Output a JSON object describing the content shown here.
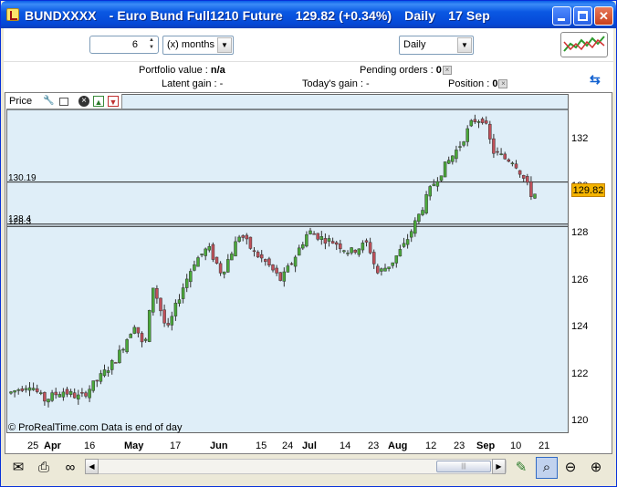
{
  "window": {
    "symbol": "BUNDXXXX",
    "instrument": "- Euro Bund Full1210 Future",
    "quote": "129.82 (+0.34%)",
    "period": "Daily",
    "date": "17 Sep",
    "min_glyph": "",
    "max_glyph": "",
    "close_glyph": "✕"
  },
  "toolbar": {
    "history_value": "6",
    "history_unit": "(x) months",
    "timeframe": "Daily"
  },
  "info": {
    "portfolio_label": "Portfolio value :",
    "portfolio_value": "n/a",
    "pending_label": "Pending orders :",
    "pending_value": "0",
    "latent_label": "Latent gain :",
    "latent_value": "-",
    "today_label": "Today's gain :",
    "today_value": "-",
    "position_label": "Position :",
    "position_value": "0"
  },
  "chart": {
    "panel_label": "Price",
    "copyright": "© ProRealTime.com  Data is end of day",
    "last_price": "129.82",
    "level_high": "130.19",
    "level_low_a": "128.4",
    "level_low_b": "128.3",
    "yticks": [
      "132",
      "130",
      "128",
      "126",
      "124",
      "122",
      "120"
    ],
    "xticks": [
      {
        "label": "25",
        "major": false
      },
      {
        "label": "Apr",
        "major": true
      },
      {
        "label": "16",
        "major": false
      },
      {
        "label": "May",
        "major": true
      },
      {
        "label": "17",
        "major": false
      },
      {
        "label": "Jun",
        "major": true
      },
      {
        "label": "15",
        "major": false
      },
      {
        "label": "24",
        "major": false
      },
      {
        "label": "Jul",
        "major": true
      },
      {
        "label": "14",
        "major": false
      },
      {
        "label": "23",
        "major": false
      },
      {
        "label": "Aug",
        "major": true
      },
      {
        "label": "12",
        "major": false
      },
      {
        "label": "23",
        "major": false
      },
      {
        "label": "Sep",
        "major": true
      },
      {
        "label": "10",
        "major": false
      },
      {
        "label": "21",
        "major": false
      }
    ]
  },
  "colors": {
    "up": "#4aa83a",
    "down": "#c0505a",
    "plot_bg": "#dfeef8",
    "badge": "#f5b400"
  }
}
